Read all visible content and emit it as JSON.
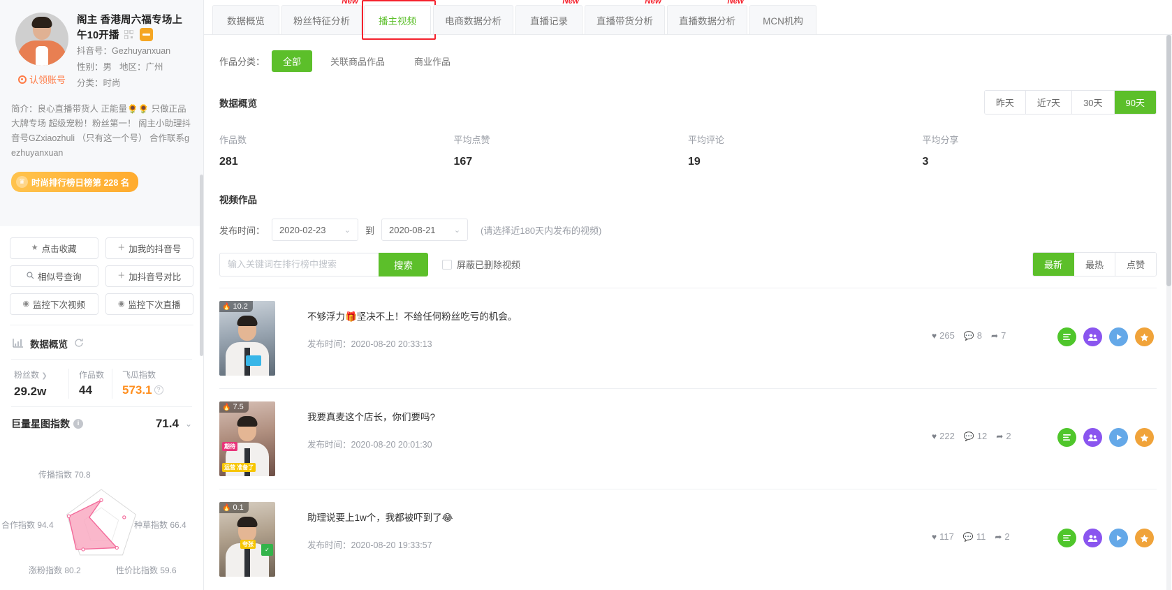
{
  "profile": {
    "nickname": "阁主 香港周六福专场上午10开播",
    "qr_icon": "qr-code-icon",
    "platform_badge": "douyin-badge-icon",
    "claim_label": "认领账号",
    "claim_icon": "target-ring-icon",
    "douyin_id_label": "抖音号：",
    "douyin_id": "Gezhuyanxuan",
    "gender_label": "性别：",
    "gender": "男",
    "region_label": "地区：",
    "region": "广州",
    "category_label": "分类：",
    "category": "时尚",
    "bio_label": "简介：",
    "bio": "良心直播带货人 正能量🌻🌻 只做正品大牌专场 超级宠粉！粉丝第一！ 阁主小助理抖音号GZxiaozhuli （只有这一个号） 合作联系gezhuyanxuan",
    "rank_badge": "时尚排行榜日榜第 228 名",
    "rank_icon": "crown-icon"
  },
  "sidebar_buttons": [
    {
      "label": "点击收藏",
      "icon": "star-icon",
      "glyph": "★"
    },
    {
      "label": "加我的抖音号",
      "icon": "plus-icon",
      "glyph": "＋"
    },
    {
      "label": "相似号查询",
      "icon": "search-icon",
      "glyph": "🔍"
    },
    {
      "label": "加抖音号对比",
      "icon": "plus-icon",
      "glyph": "＋"
    },
    {
      "label": "监控下次视频",
      "icon": "eye-icon",
      "glyph": "◉"
    },
    {
      "label": "监控下次直播",
      "icon": "eye-icon",
      "glyph": "◉"
    }
  ],
  "data_overview": {
    "title": "数据概览",
    "refresh_icon": "refresh-icon",
    "stats": [
      {
        "label": "粉丝数",
        "value": "29.2w",
        "has_arrow": true
      },
      {
        "label": "作品数",
        "value": "44",
        "has_arrow": false
      },
      {
        "label": "飞瓜指数",
        "value": "573.1",
        "has_arrow": false,
        "highlight": true,
        "help_icon": "question-icon"
      }
    ],
    "xingtu": {
      "label": "巨量星图指数",
      "info_icon": "info-icon",
      "value": "71.4",
      "chevron_icon": "chevron-down-icon"
    }
  },
  "chart_data": {
    "type": "radar",
    "title": "巨量星图指数",
    "categories": [
      "传播指数",
      "种草指数",
      "性价比指数",
      "涨粉指数",
      "合作指数"
    ],
    "values": [
      70.8,
      66.4,
      59.6,
      80.2,
      94.4
    ],
    "labels": [
      "传播指数 70.8",
      "种草指数 66.4",
      "性价比指数 59.6",
      "涨粉指数 80.2",
      "合作指数 94.4"
    ],
    "max": 100,
    "fill_color": "#f8a3bd",
    "stroke_color": "#f36a9a",
    "grid": true,
    "legend": "none"
  },
  "tabs": [
    {
      "label": "数据概览",
      "new": false,
      "active": false
    },
    {
      "label": "粉丝特征分析",
      "new": true,
      "active": false
    },
    {
      "label": "播主视频",
      "new": false,
      "active": true,
      "highlight": true
    },
    {
      "label": "电商数据分析",
      "new": false,
      "active": false
    },
    {
      "label": "直播记录",
      "new": true,
      "active": false
    },
    {
      "label": "直播带货分析",
      "new": true,
      "active": false
    },
    {
      "label": "直播数据分析",
      "new": true,
      "active": false
    },
    {
      "label": "MCN机构",
      "new": false,
      "active": false
    }
  ],
  "new_flag": "New",
  "category_filter": {
    "label": "作品分类：",
    "options": [
      {
        "label": "全部",
        "active": true
      },
      {
        "label": "关联商品作品",
        "active": false
      },
      {
        "label": "商业作品",
        "active": false
      }
    ]
  },
  "overview": {
    "title": "数据概览",
    "ranges": [
      {
        "label": "昨天",
        "active": false
      },
      {
        "label": "近7天",
        "active": false
      },
      {
        "label": "30天",
        "active": false
      },
      {
        "label": "90天",
        "active": true
      }
    ],
    "kpis": [
      {
        "label": "作品数",
        "value": "281"
      },
      {
        "label": "平均点赞",
        "value": "167"
      },
      {
        "label": "平均评论",
        "value": "19"
      },
      {
        "label": "平均分享",
        "value": "3"
      }
    ]
  },
  "videos_section": {
    "title": "视频作品",
    "date_label": "发布时间：",
    "date_from": "2020-02-23",
    "date_to": "2020-08-21",
    "date_to_label": "到",
    "date_hint": "(请选择近180天内发布的视频)",
    "search_placeholder": "输入关键词在排行榜中搜索",
    "search_value": "",
    "search_button": "搜索",
    "checkbox_label": "屏蔽已删除视频",
    "checkbox_checked": false,
    "sorts": [
      {
        "label": "最新",
        "active": true
      },
      {
        "label": "最热",
        "active": false
      },
      {
        "label": "点赞",
        "active": false
      }
    ]
  },
  "videos": [
    {
      "hot_score": "10.2",
      "hot_icon": "flame-icon",
      "title": "不够浮力🎁坚决不上！不给任何粉丝吃亏的机会。",
      "time_label": "发布时间：",
      "time": "2020-08-20 20:33:13",
      "likes": "265",
      "comments": "8",
      "shares": "7",
      "thumb_class": "t1"
    },
    {
      "hot_score": "7.5",
      "hot_icon": "flame-icon",
      "title": "我要真麦这个店长，你们要吗?",
      "time_label": "发布时间：",
      "time": "2020-08-20 20:01:30",
      "likes": "222",
      "comments": "12",
      "shares": "2",
      "thumb_class": "t2"
    },
    {
      "hot_score": "0.1",
      "hot_icon": "flame-icon",
      "title": "助理说要上1w个，我都被吓到了😂",
      "time_label": "发布时间：",
      "time": "2020-08-20 19:33:57",
      "likes": "117",
      "comments": "11",
      "shares": "2",
      "thumb_class": "t3"
    }
  ],
  "row_icons": {
    "like": "heart-icon",
    "comment": "comment-icon",
    "share": "share-icon",
    "actions": [
      {
        "name": "transcript-icon",
        "color": "#4fc62b"
      },
      {
        "name": "fans-icon",
        "color": "#8a55ef"
      },
      {
        "name": "play-icon",
        "color": "#64a8e8"
      },
      {
        "name": "star-icon",
        "color": "#f0a33a"
      }
    ]
  },
  "colors": {
    "accent_green": "#5cbf2a",
    "orange": "#ff8f1f",
    "red": "#f5222d",
    "pink": "#f36a9a"
  }
}
